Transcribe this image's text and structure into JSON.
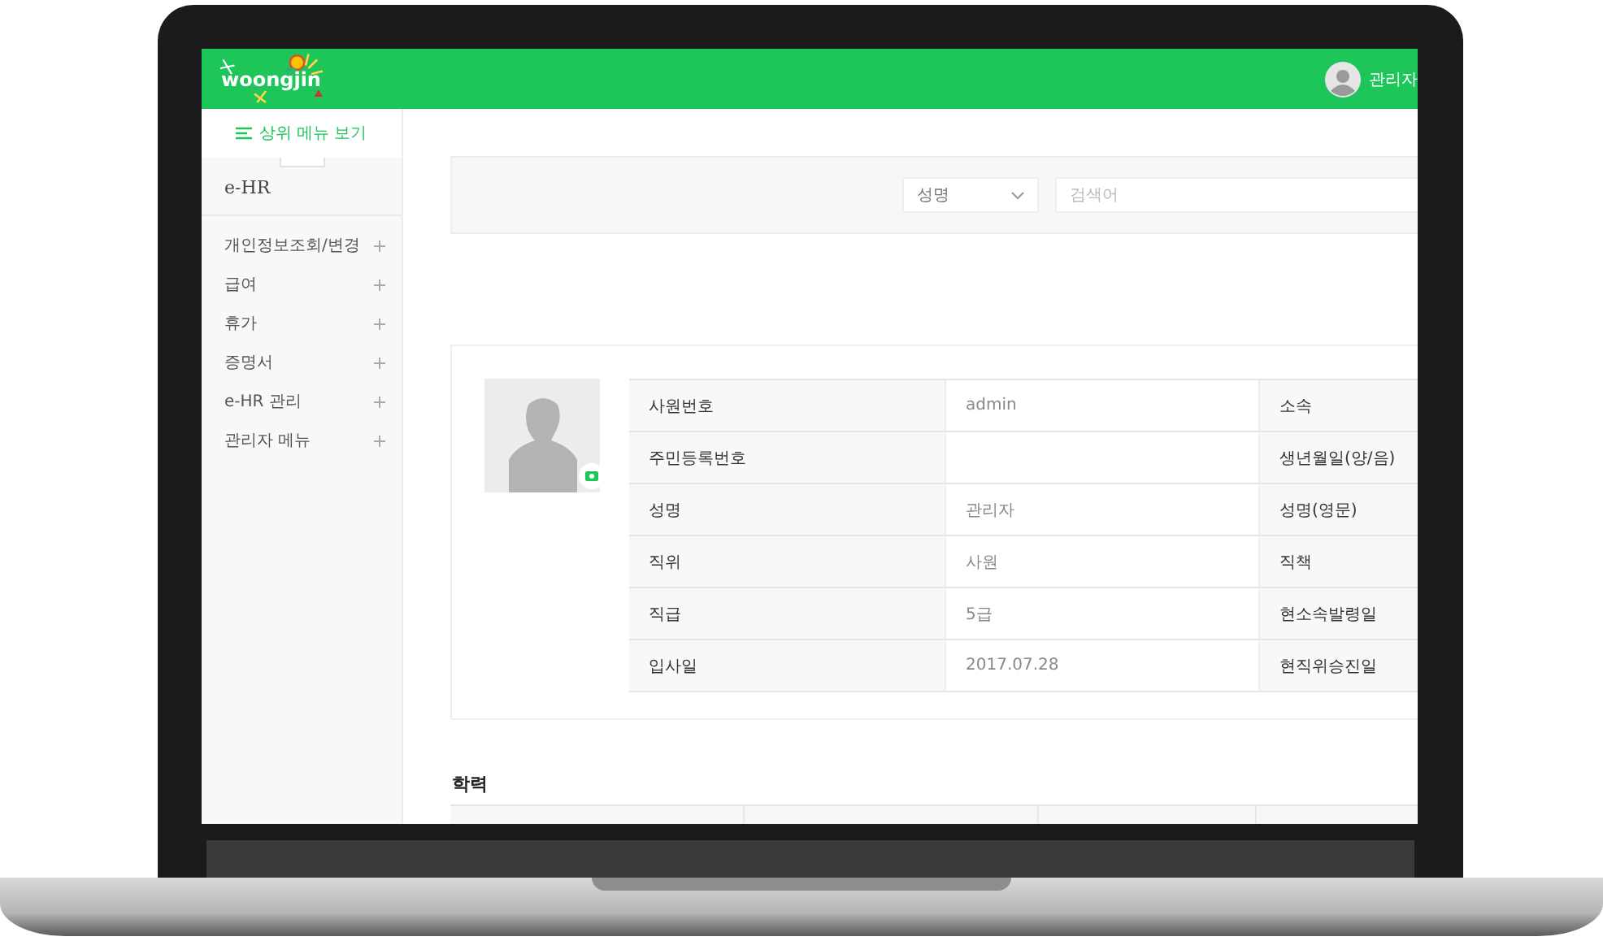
{
  "header": {
    "logo": "woongjin",
    "user": {
      "name": "관리자"
    }
  },
  "sidebar": {
    "top_button": "상위 메뉴 보기",
    "section_title": "e-HR",
    "items": [
      {
        "label": "개인정보조회/변경",
        "expanded": false
      },
      {
        "label": "급여",
        "expanded": false
      },
      {
        "label": "휴가",
        "expanded": false
      },
      {
        "label": "증명서",
        "expanded": false
      },
      {
        "label": "e-HR 관리",
        "expanded": false
      },
      {
        "label": "관리자 메뉴",
        "expanded": false
      }
    ]
  },
  "search": {
    "field_select": "성명",
    "placeholder": "검색어"
  },
  "profile": {
    "rows": [
      {
        "label": "사원번호",
        "value": "admin",
        "label_2": "소속"
      },
      {
        "label": "주민등록번호",
        "value": "",
        "label_2": "생년월일(양/음)"
      },
      {
        "label": "성명",
        "value": "관리자",
        "label_2": "성명(영문)"
      },
      {
        "label": "직위",
        "value": "사원",
        "label_2": "직책"
      },
      {
        "label": "직급",
        "value": "5급",
        "label_2": "현소속발령일"
      },
      {
        "label": "입사일",
        "value": "2017.07.28",
        "label_2": "현직위승진일"
      }
    ]
  },
  "education": {
    "title": "학력"
  }
}
